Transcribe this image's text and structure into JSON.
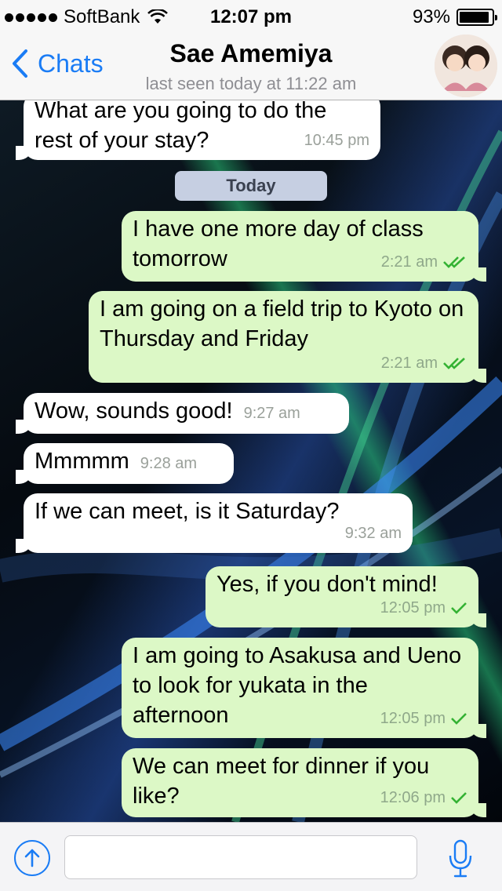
{
  "status_bar": {
    "carrier": "SoftBank",
    "time": "12:07 pm",
    "battery": "93%",
    "battery_level": 0.93,
    "signal_bars": 5
  },
  "nav": {
    "back_label": "Chats",
    "title": "Sae Amemiya",
    "subtitle": "last seen today at 11:22 am",
    "avatar_icon": "profile-photo-icon"
  },
  "chat": {
    "date_divider": "Today",
    "messages": [
      {
        "direction": "in",
        "text": "What are you going to do the rest of your stay?",
        "time": "10:45 pm",
        "status": ""
      },
      {
        "direction": "out",
        "text": "I have one more day of class tomorrow",
        "time": "2:21 am",
        "status": "read"
      },
      {
        "direction": "out",
        "text": "I am going on a field trip to Kyoto on Thursday and Friday",
        "time": "2:21 am",
        "status": "read"
      },
      {
        "direction": "in",
        "text": "Wow, sounds good!",
        "time": "9:27 am",
        "status": ""
      },
      {
        "direction": "in",
        "text": "Mmmmm",
        "time": "9:28 am",
        "status": ""
      },
      {
        "direction": "in",
        "text": "If we can meet, is it Saturday?",
        "time": "9:32 am",
        "status": ""
      },
      {
        "direction": "out",
        "text": "Yes, if you don't mind!",
        "time": "12:05 pm",
        "status": "delivered"
      },
      {
        "direction": "out",
        "text": "I am going to Asakusa and Ueno to look for yukata in the afternoon",
        "time": "12:05 pm",
        "status": "delivered"
      },
      {
        "direction": "out",
        "text": "We can meet for dinner if you like?",
        "time": "12:06 pm",
        "status": "delivered"
      }
    ]
  },
  "input_bar": {
    "placeholder": "",
    "upload_icon": "upload-arrow-icon",
    "mic_icon": "microphone-icon"
  },
  "colors": {
    "accent": "#1a7cf5",
    "outgoing_bubble": "#dcf8c6",
    "incoming_bubble": "#ffffff",
    "check_color": "#34b233"
  }
}
